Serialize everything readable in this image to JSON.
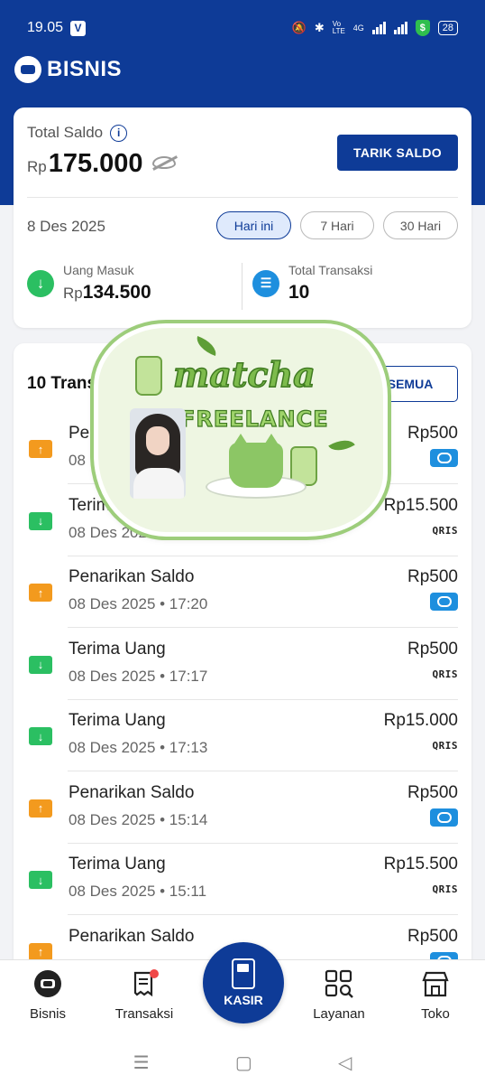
{
  "status": {
    "time": "19.05",
    "v_badge": "V",
    "battery": "28",
    "network": "4G",
    "volte": "Vo LTE",
    "shield": "$"
  },
  "header": {
    "brand": "BISNIS"
  },
  "balance": {
    "label": "Total Saldo",
    "currency": "Rp",
    "amount": "175.000",
    "withdraw_label": "TARIK SALDO",
    "date": "8 Des 2025",
    "filters": [
      "Hari ini",
      "7 Hari",
      "30 Hari"
    ],
    "active_filter": "Hari ini",
    "money_in_label": "Uang Masuk",
    "money_in_currency": "Rp",
    "money_in_value": "134.500",
    "tx_total_label": "Total Transaksi",
    "tx_total_value": "10"
  },
  "transactions": {
    "title": "10 Transaksi",
    "see_all": "LIHAT SEMUA",
    "items": [
      {
        "name": "Penarikan Saldo",
        "time": "08 Des 2025 • 18:12",
        "amount": "Rp500",
        "type": "out",
        "method": "bisnis"
      },
      {
        "name": "Terima Uang",
        "time": "08 Des 2025 • 18:12",
        "amount": "Rp15.500",
        "type": "in",
        "method": "qris"
      },
      {
        "name": "Penarikan Saldo",
        "time": "08 Des 2025 • 17:20",
        "amount": "Rp500",
        "type": "out",
        "method": "bisnis"
      },
      {
        "name": "Terima Uang",
        "time": "08 Des 2025 • 17:17",
        "amount": "Rp500",
        "type": "in",
        "method": "qris"
      },
      {
        "name": "Terima Uang",
        "time": "08 Des 2025 • 17:13",
        "amount": "Rp15.000",
        "type": "in",
        "method": "qris"
      },
      {
        "name": "Penarikan Saldo",
        "time": "08 Des 2025 • 15:14",
        "amount": "Rp500",
        "type": "out",
        "method": "bisnis"
      },
      {
        "name": "Terima Uang",
        "time": "08 Des 2025 • 15:11",
        "amount": "Rp15.500",
        "type": "in",
        "method": "qris"
      },
      {
        "name": "Penarikan Saldo",
        "time": "",
        "amount": "Rp500",
        "type": "out",
        "method": "bisnis"
      }
    ],
    "qris_label": "QRIS"
  },
  "sticker": {
    "title": "matcha",
    "subtitle": "FREELANCE"
  },
  "nav": {
    "items": [
      {
        "label": "Bisnis",
        "icon": "bisnis-logo-icon"
      },
      {
        "label": "Transaksi",
        "icon": "receipt-icon"
      },
      {
        "label": "Layanan",
        "icon": "grid-search-icon"
      },
      {
        "label": "Toko",
        "icon": "store-icon"
      }
    ],
    "center_label": "KASIR",
    "center_icon": "pos-terminal-icon"
  },
  "colors": {
    "primary": "#0e3b97",
    "money_in": "#2bbf62",
    "money_out": "#f39a1e",
    "qris_badge": "#1e8fde"
  }
}
